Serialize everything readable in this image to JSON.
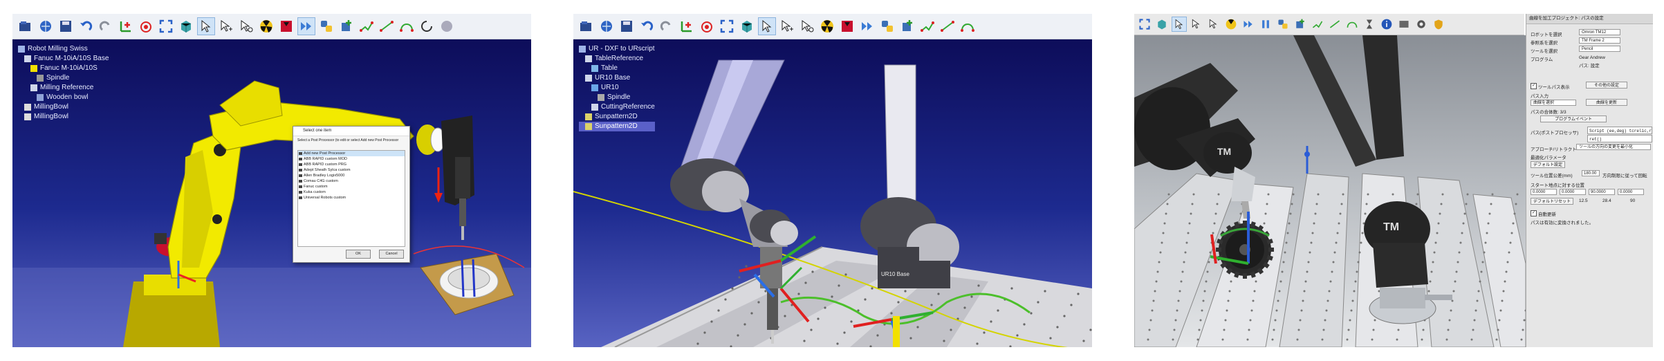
{
  "panel1": {
    "tree": [
      {
        "label": "Robot Milling Swiss",
        "indent": 0,
        "icon": "station-icon"
      },
      {
        "label": "Fanuc M-10iA/10S Base",
        "indent": 1,
        "icon": "frame-icon"
      },
      {
        "label": "Fanuc M-10iA/10S",
        "indent": 2,
        "icon": "robot-icon"
      },
      {
        "label": "Spindle",
        "indent": 3,
        "icon": "tool-icon"
      },
      {
        "label": "Milling Reference",
        "indent": 2,
        "icon": "frame-icon"
      },
      {
        "label": "Wooden bowl",
        "indent": 3,
        "icon": "object-icon"
      },
      {
        "label": "MillingBowl",
        "indent": 1,
        "icon": "program-icon"
      },
      {
        "label": "MillingBowl",
        "indent": 1,
        "icon": "program-icon"
      }
    ],
    "dialog": {
      "title": "Select one item",
      "message": "Select a Post Processor (to edit or select Add new Post Processor",
      "items": [
        "Add new Post Processor",
        "ABB RAPID custom MOD",
        "ABB RAPID custom PRG",
        "Adept Sheath Sylca custom",
        "Allen Bradley Logix5000",
        "Comau C4G custom",
        "Fanuc custom",
        "Kuka custom",
        "Universal Robots custom"
      ],
      "ok": "OK",
      "cancel": "Cancel"
    }
  },
  "panel2": {
    "tree": [
      {
        "label": "UR - DXF to URscript",
        "indent": 0
      },
      {
        "label": "TableReference",
        "indent": 1
      },
      {
        "label": "Table",
        "indent": 2
      },
      {
        "label": "UR10 Base",
        "indent": 1
      },
      {
        "label": "UR10",
        "indent": 2
      },
      {
        "label": "Spindle",
        "indent": 3
      },
      {
        "label": "CuttingReference",
        "indent": 2
      },
      {
        "label": "Sunpattern2D",
        "indent": 1
      },
      {
        "label": "Sunpattern2D",
        "indent": 1,
        "selected": true
      }
    ],
    "robot_label": "UR10 Base"
  },
  "panel3": {
    "robot_logo": "TM",
    "side": {
      "title": "曲線を加工プロジェクト: パスの設定",
      "robot_label": "ロボットを選択",
      "robot_value": "Omron TM12",
      "ref_label": "参照系を選択",
      "ref_value": "TM Frame 2",
      "tool_label": "ツールを選択",
      "tool_value": "Pencil",
      "prog_label": "プログラム",
      "prog_value": "Gear Andrew",
      "path_label": "パス: 設定",
      "show_path": "ツールパス表示",
      "opt_btn": "その他の設定",
      "path_input": "パス入力",
      "path_select": "曲線を選択",
      "update_btn": "曲線を更新",
      "path_count": "パスの合体数: 3/3",
      "prog_event": "プログラムイベント",
      "post_label": "パス(ポストプロセッサ)",
      "script_value": "Script (ee,deg) tcrelic,r",
      "ret_value": "ret()",
      "algo_label": "アプローチ/リトラクト",
      "algo_value": "ツールの方向の変更を最小化",
      "opt_param": "最適化パラメータ",
      "default_btn": "デフォルト設定",
      "tol_label": "ツール位置公差(mm)",
      "tol_value": "180.00",
      "tol_note": "方向制限に従って回転",
      "start_label": "スタート地点に対する位置",
      "start_values": [
        "0.0000",
        "0.0000",
        "90.0000",
        "0.0000"
      ],
      "reset_btn": "デフォルトリセット",
      "extra_values": [
        "12.5",
        "28.4",
        "90"
      ],
      "auto_update": "自動更新",
      "status": "パスは有効に変換されました。"
    }
  }
}
